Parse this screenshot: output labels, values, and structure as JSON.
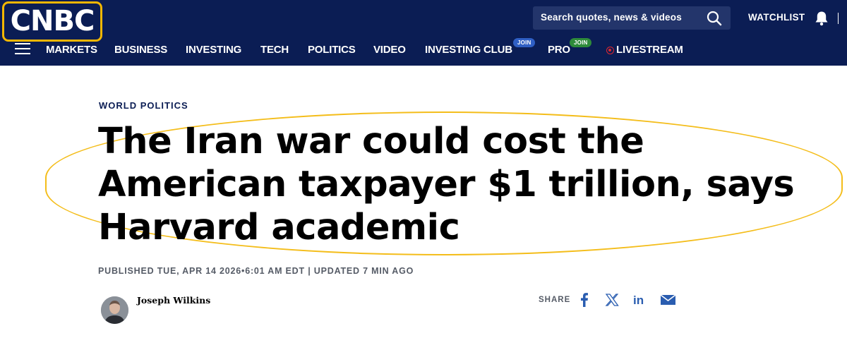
{
  "header": {
    "logo_text": "CNBC",
    "search_placeholder": "Search quotes, news & videos",
    "watchlist_label": "WATCHLIST"
  },
  "nav": {
    "items": [
      {
        "label": "MARKETS"
      },
      {
        "label": "BUSINESS"
      },
      {
        "label": "INVESTING"
      },
      {
        "label": "TECH"
      },
      {
        "label": "POLITICS"
      },
      {
        "label": "VIDEO"
      },
      {
        "label": "INVESTING CLUB",
        "badge": "JOIN"
      },
      {
        "label": "PRO",
        "badge": "JOIN"
      },
      {
        "label": "LIVESTREAM"
      }
    ]
  },
  "article": {
    "kicker": "WORLD POLITICS",
    "headline": "The Iran war could cost the American taxpayer $1 trillion, says Harvard academic",
    "published_line": "PUBLISHED TUE, APR 14 2026•6:01 AM EDT | UPDATED 7 MIN AGO",
    "author": "Joseph Wilkins"
  },
  "share": {
    "label": "SHARE",
    "icons": [
      "facebook-icon",
      "x-icon",
      "linkedin-icon",
      "email-icon"
    ]
  },
  "colors": {
    "nav_background": "#0b1d54",
    "highlight_outline": "#f4bd1a",
    "share_icon_blue": "#2a5db0",
    "investing_club_badge": "#2f5fc4",
    "pro_badge": "#2e8b3a",
    "livestream_red": "#e0262f"
  }
}
